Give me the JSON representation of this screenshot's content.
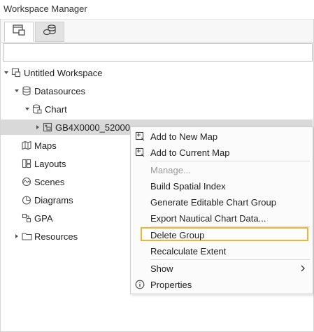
{
  "window": {
    "title": "Workspace Manager"
  },
  "tabs": [
    {
      "icon": "workspace-layers-icon"
    },
    {
      "icon": "datasource-stack-icon"
    }
  ],
  "search": {
    "value": "",
    "placeholder": ""
  },
  "tree": {
    "workspace": "Untitled Workspace",
    "datasources": "Datasources",
    "chart": "Chart",
    "dataset": "GB4X0000_52000",
    "maps": "Maps",
    "layouts": "Layouts",
    "scenes": "Scenes",
    "diagrams": "Diagrams",
    "gpa": "GPA",
    "resources": "Resources"
  },
  "context_menu": {
    "add_new_map": "Add to New Map",
    "add_current_map": "Add to Current Map",
    "manage": "Manage...",
    "build_index": "Build Spatial Index",
    "generate_group": "Generate Editable Chart Group",
    "export_data": "Export Nautical Chart Data...",
    "delete_group": "Delete Group",
    "recalculate": "Recalculate Extent",
    "show": "Show",
    "properties": "Properties"
  },
  "colors": {
    "highlight_border": "#f2b330",
    "selected_row": "#d9d9d9"
  }
}
